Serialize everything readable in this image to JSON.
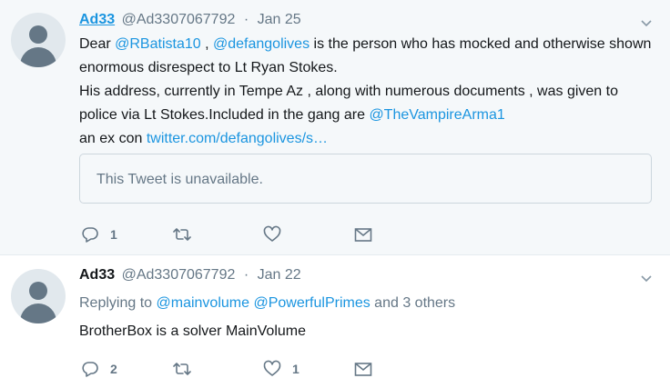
{
  "tweets": [
    {
      "name": "Ad33",
      "handle": "@Ad3307067792",
      "dot": "·",
      "date": "Jan 25",
      "text": {
        "p1_pre": "Dear ",
        "mention1": "@RBatista10",
        "p1_mid": " , ",
        "mention2": "@defangolives",
        "p1_post": " is the person who has mocked and otherwise shown enormous disrespect to Lt Ryan Stokes.",
        "p2_pre": "His address, currently in Tempe Az , along with numerous documents , was given to police via Lt Stokes.Included in the gang are ",
        "mention3": "@TheVampireArma1",
        "p3_pre": "an ex con ",
        "url": "twitter.com/defangolives/s…"
      },
      "quote": "This Tweet is unavailable.",
      "actions": {
        "reply_count": "1",
        "retweet_count": "",
        "like_count": ""
      }
    },
    {
      "name": "Ad33",
      "handle": "@Ad3307067792",
      "dot": "·",
      "date": "Jan 22",
      "replying": {
        "prefix": "Replying to ",
        "user1": "@mainvolume",
        "user2": "@PowerfulPrimes",
        "suffix": " and 3 others"
      },
      "text": "BrotherBox is a solver MainVolume",
      "actions": {
        "reply_count": "2",
        "retweet_count": "",
        "like_count": "1"
      }
    }
  ],
  "icons": {
    "reply": "reply-icon",
    "retweet": "retweet-icon",
    "like": "heart-icon",
    "dm": "envelope-icon",
    "caret": "chevron-down-icon"
  },
  "colors": {
    "link": "#1b95e0",
    "muted": "#657786",
    "text": "#14171a",
    "bg_highlight": "#f5f8fa"
  }
}
